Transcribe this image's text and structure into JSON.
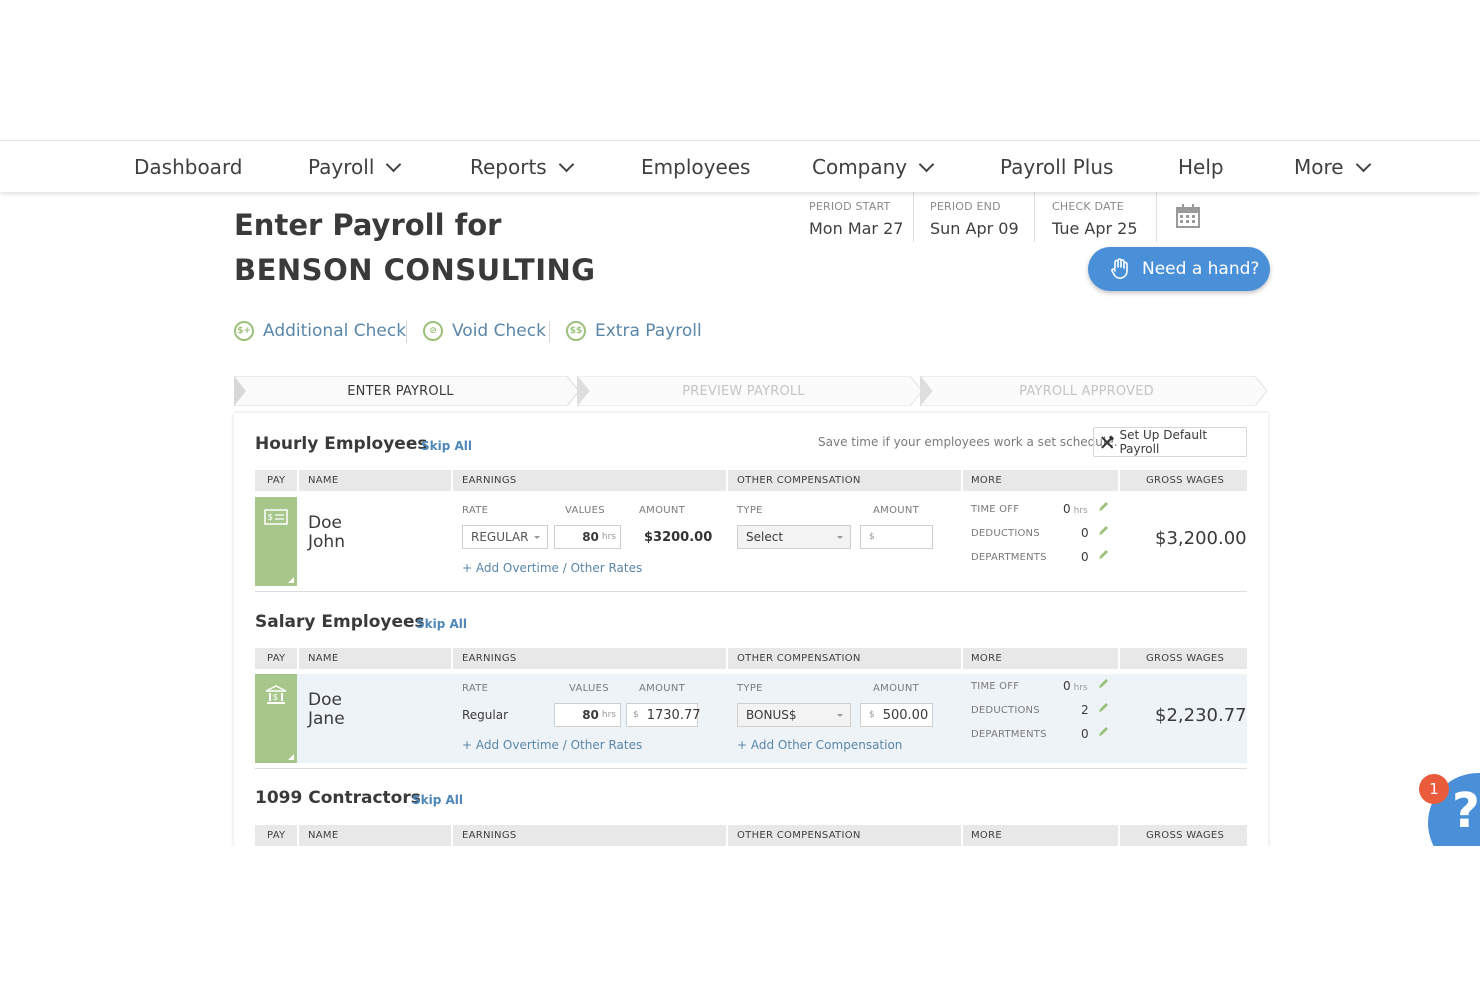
{
  "nav": {
    "items": [
      {
        "label": "Dashboard",
        "dropdown": false
      },
      {
        "label": "Payroll",
        "dropdown": true
      },
      {
        "label": "Reports",
        "dropdown": true
      },
      {
        "label": "Employees",
        "dropdown": false
      },
      {
        "label": "Company",
        "dropdown": true
      },
      {
        "label": "Payroll Plus",
        "dropdown": false
      },
      {
        "label": "Help",
        "dropdown": false
      },
      {
        "label": "More",
        "dropdown": true
      }
    ]
  },
  "header": {
    "title_line1": "Enter Payroll for",
    "title_line2": "BENSON CONSULTING",
    "period_start_label": "PERIOD START",
    "period_start": "Mon Mar 27",
    "period_end_label": "PERIOD END",
    "period_end": "Sun Apr 09",
    "check_date_label": "CHECK DATE",
    "check_date": "Tue Apr 25",
    "help_button": "Need a hand?"
  },
  "actions": {
    "additional_check": "Additional Check",
    "void_check": "Void Check",
    "extra_payroll": "Extra Payroll"
  },
  "steps": [
    "ENTER PAYROLL",
    "PREVIEW PAYROLL",
    "PAYROLL APPROVED"
  ],
  "table_headers": {
    "pay": "PAY",
    "name": "NAME",
    "earnings": "EARNINGS",
    "other_comp": "OTHER COMPENSATION",
    "more": "MORE",
    "gross": "GROSS WAGES"
  },
  "sub_headers": {
    "rate": "RATE",
    "values": "VALUES",
    "amount": "AMOUNT",
    "type": "TYPE",
    "time_off": "TIME OFF",
    "deductions": "DEDUCTIONS",
    "departments": "DEPARTMENTS",
    "hrs": "hrs",
    "dollar": "$"
  },
  "hourly": {
    "title": "Hourly Employees",
    "skip": "Skip All",
    "hint": "Save time if your employees work a set schedule.",
    "setup_button": "Set Up Default Payroll",
    "employee": {
      "last": "Doe",
      "first": "John",
      "rate": "REGULAR",
      "hours": "80",
      "amount": "$3200.00",
      "comp_type": "Select",
      "comp_amount": "",
      "add_rates": "+ Add Overtime / Other Rates",
      "time_off": "0",
      "deductions": "0",
      "departments": "0",
      "gross": "$3,200.00"
    }
  },
  "salary": {
    "title": "Salary Employees",
    "skip": "Skip All",
    "employee": {
      "last": "Doe",
      "first": "Jane",
      "rate": "Regular",
      "hours": "80",
      "amount": "1730.77",
      "comp_type": "BONUS$",
      "comp_amount": "500.00",
      "add_rates": "+ Add Overtime / Other Rates",
      "add_comp": "+ Add Other Compensation",
      "time_off": "0",
      "deductions": "2",
      "departments": "0",
      "gross": "$2,230.77"
    }
  },
  "contractors": {
    "title": "1099 Contractors",
    "skip": "Skip All"
  },
  "chat": {
    "badge": "1",
    "icon": "?"
  },
  "colors": {
    "accent": "#4a90d9",
    "pay_green": "#a6c68a",
    "link": "#5a86a8"
  }
}
